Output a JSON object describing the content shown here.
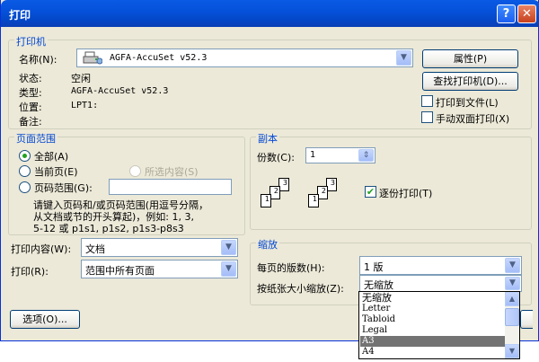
{
  "title": "打印",
  "title_buttons": {
    "help": "?",
    "close": "✕"
  },
  "printer": {
    "legend": "打印机",
    "name_label": "名称(N):",
    "name_value": "AGFA-AccuSet v52.3",
    "status_label": "状态:",
    "status_value": "空闲",
    "type_label": "类型:",
    "type_value": "AGFA-AccuSet v52.3",
    "location_label": "位置:",
    "location_value": "LPT1:",
    "comment_label": "备注:",
    "properties_button": "属性(P)",
    "find_button": "查找打印机(D)...",
    "print_to_file": "打印到文件(L)",
    "manual_duplex": "手动双面打印(X)"
  },
  "range": {
    "legend": "页面范围",
    "all": "全部(A)",
    "current": "当前页(E)",
    "selection": "所选内容(S)",
    "pages": "页码范围(G):",
    "pages_value": "",
    "hint_line1": "请键入页码和/或页码范围(用逗号分隔，",
    "hint_line2": "从文档或节的开头算起)，例如: 1, 3,",
    "hint_line3": "5-12 或 p1s1, p1s2, p1s3-p8s3"
  },
  "copies": {
    "legend": "副本",
    "count_label": "份数(C):",
    "count_value": "1",
    "collate": "逐份打印(T)",
    "pages": [
      "3",
      "2",
      "1",
      "3",
      "2",
      "1"
    ]
  },
  "print_what": {
    "label": "打印内容(W):",
    "value": "文档"
  },
  "print": {
    "label": "打印(R):",
    "value": "范围中所有页面"
  },
  "zoom": {
    "legend": "缩放",
    "per_sheet_label": "每页的版数(H):",
    "per_sheet_value": "1 版",
    "scale_label": "按纸张大小缩放(Z):",
    "scale_value": "无缩放",
    "options": [
      "无缩放",
      "Letter",
      "Tabloid",
      "Legal",
      "A3",
      "A4"
    ]
  },
  "options_button": "选项(O)..."
}
